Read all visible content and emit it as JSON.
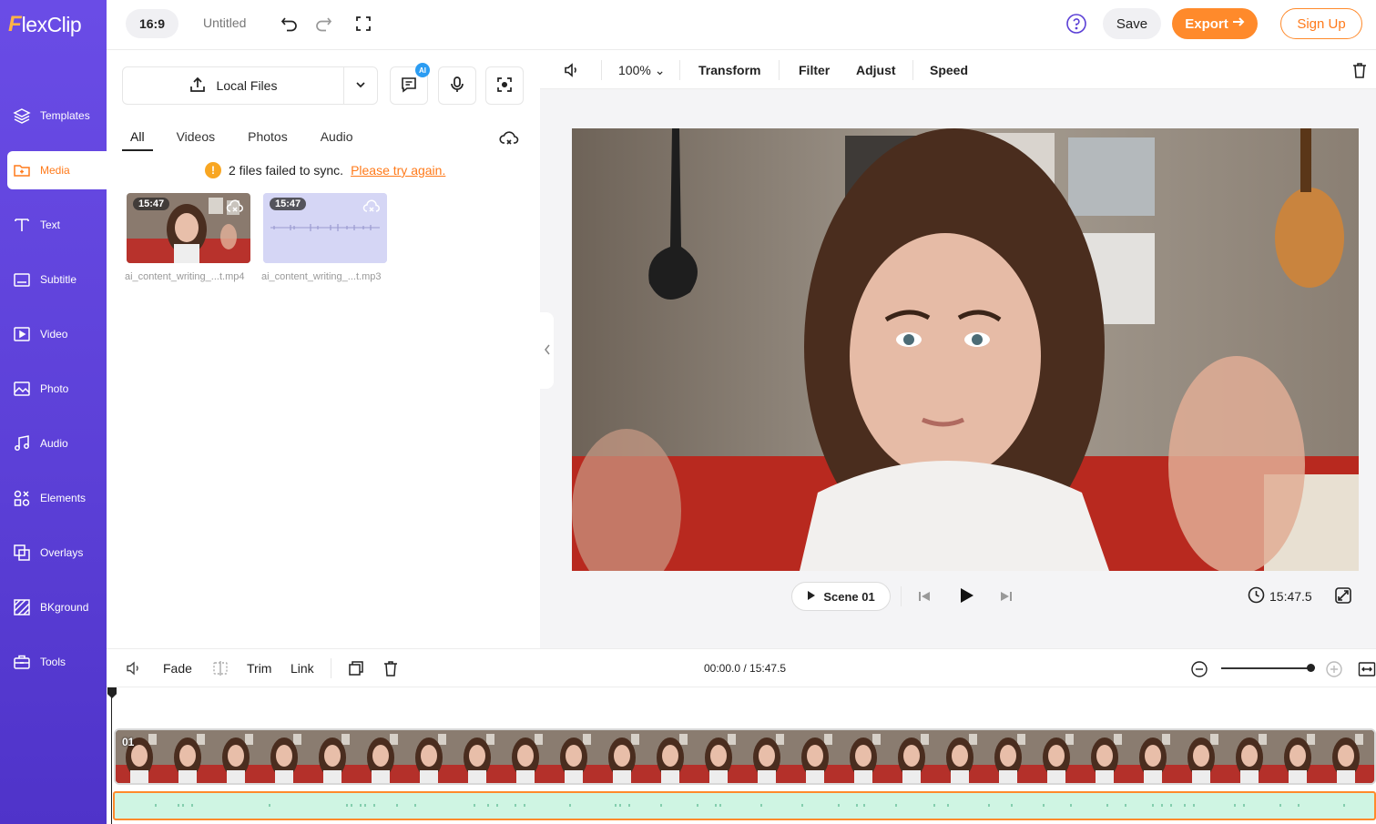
{
  "app": {
    "logo_first": "F",
    "logo_rest": "lexClip",
    "brand_color": "#6a4ce6",
    "accent_color": "#ff8a2b"
  },
  "sidebar": {
    "items": [
      {
        "label": "Templates",
        "icon": "layers-icon"
      },
      {
        "label": "Media",
        "icon": "folder-plus-icon",
        "active": true
      },
      {
        "label": "Text",
        "icon": "text-icon"
      },
      {
        "label": "Subtitle",
        "icon": "subtitle-icon"
      },
      {
        "label": "Video",
        "icon": "video-icon"
      },
      {
        "label": "Photo",
        "icon": "photo-icon"
      },
      {
        "label": "Audio",
        "icon": "music-icon"
      },
      {
        "label": "Elements",
        "icon": "elements-icon"
      },
      {
        "label": "Overlays",
        "icon": "overlays-icon"
      },
      {
        "label": "BKground",
        "icon": "background-icon"
      },
      {
        "label": "Tools",
        "icon": "toolbox-icon"
      }
    ]
  },
  "topbar": {
    "ratio": "16:9",
    "title": "Untitled",
    "save_label": "Save",
    "export_label": "Export",
    "signup_label": "Sign Up"
  },
  "media": {
    "upload_label": "Local Files",
    "ai_badge": "AI",
    "tabs": [
      "All",
      "Videos",
      "Photos",
      "Audio"
    ],
    "active_tab": "All",
    "sync_message": "2 files failed to sync.",
    "retry_link": "Please try again.",
    "files": [
      {
        "duration": "15:47",
        "name": "ai_content_writing_...t.mp4"
      },
      {
        "duration": "15:47",
        "name": "ai_content_writing_...t.mp3"
      }
    ]
  },
  "preview": {
    "zoom": "100%",
    "tools": [
      "Transform",
      "Filter",
      "Adjust",
      "Speed"
    ],
    "scene_label": "Scene 01",
    "total_time": "15:47.5"
  },
  "timeline": {
    "fade_label": "Fade",
    "trim_label": "Trim",
    "link_label": "Link",
    "time_display": "00:00.0 / 15:47.5",
    "zoom_level": 0.98,
    "track_label": "01"
  }
}
